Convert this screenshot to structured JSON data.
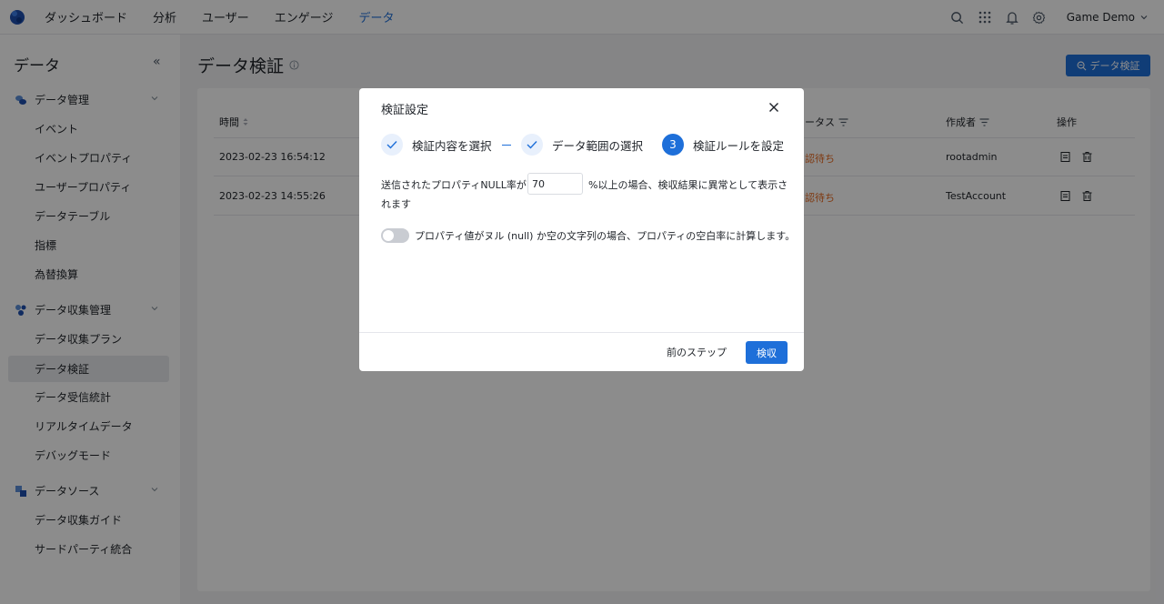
{
  "topnav": {
    "items": [
      "ダッシュボード",
      "分析",
      "ユーザー",
      "エンゲージ",
      "データ"
    ],
    "active_index": 4,
    "workspace": "Game Demo"
  },
  "sidebar": {
    "title": "データ",
    "groups": [
      {
        "label": "データ管理",
        "items": [
          "イベント",
          "イベントプロパティ",
          "ユーザープロパティ",
          "データテーブル",
          "指標",
          "為替換算"
        ]
      },
      {
        "label": "データ収集管理",
        "items": [
          "データ収集プラン",
          "データ検証",
          "データ受信統計",
          "リアルタイムデータ",
          "デバッグモード"
        ]
      },
      {
        "label": "データソース",
        "items": [
          "データ収集ガイド",
          "サードパーティ統合"
        ]
      }
    ],
    "active_item": "データ検証"
  },
  "page": {
    "title": "データ検証",
    "primary_button": "データ検証"
  },
  "table": {
    "headers": {
      "time": "時間",
      "status": "ータス",
      "creator": "作成者",
      "ops": "操作"
    },
    "rows": [
      {
        "time": "2023-02-23 16:54:12",
        "status": "認待ち",
        "creator": "rootadmin"
      },
      {
        "time": "2023-02-23 14:55:26",
        "status": "認待ち",
        "creator": "TestAccount"
      }
    ]
  },
  "modal": {
    "title": "検証設定",
    "steps": [
      {
        "label": "検証内容を選択",
        "state": "done"
      },
      {
        "label": "データ範囲の選択",
        "state": "done"
      },
      {
        "label": "検証ルールを設定",
        "state": "current",
        "number": "3"
      }
    ],
    "rule_prefix": "送信されたプロパティNULL率が",
    "null_rate_value": "70",
    "rule_suffix_line1": "%以上の場合、検収結果に異常として表示さ",
    "rule_suffix_line2": "れます",
    "toggle_label": "プロパティ値がヌル (null) か空の文字列の場合、プロパティの空白率に計算します。",
    "toggle_on": false,
    "prev_button": "前のステップ",
    "ok_button": "検収"
  },
  "colors": {
    "primary": "#1e6fd9",
    "status_warn": "#e8681e"
  }
}
